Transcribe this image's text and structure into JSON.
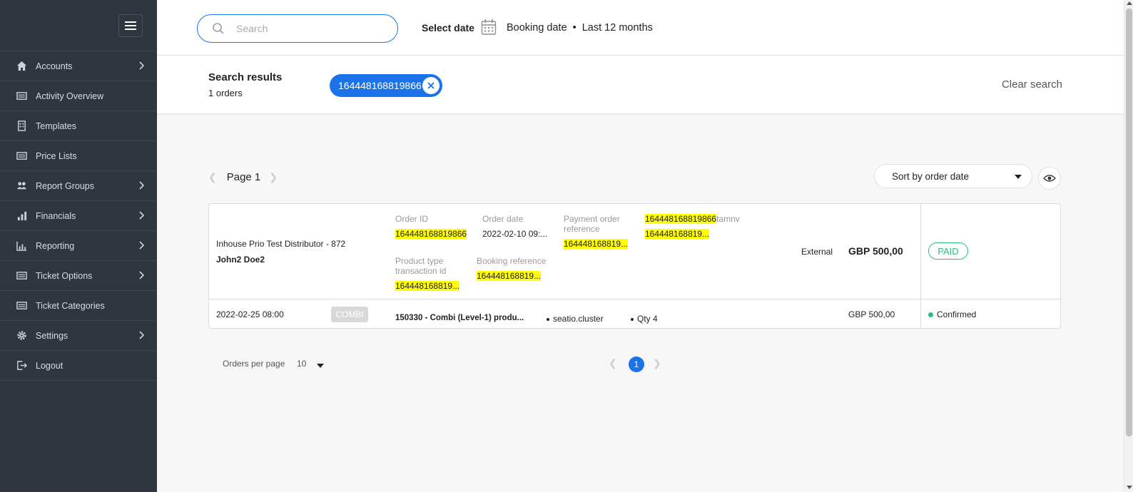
{
  "sidebar": {
    "items": [
      {
        "label": "Accounts",
        "icon": "home-icon",
        "has_submenu": true
      },
      {
        "label": "Activity Overview",
        "icon": "list-icon",
        "has_submenu": false
      },
      {
        "label": "Templates",
        "icon": "building-icon",
        "has_submenu": false
      },
      {
        "label": "Price Lists",
        "icon": "list-icon",
        "has_submenu": false
      },
      {
        "label": "Report Groups",
        "icon": "users-icon",
        "has_submenu": true
      },
      {
        "label": "Financials",
        "icon": "bar-chart-icon",
        "has_submenu": true
      },
      {
        "label": "Reporting",
        "icon": "chart-icon",
        "has_submenu": true
      },
      {
        "label": "Ticket Options",
        "icon": "list-icon",
        "has_submenu": true
      },
      {
        "label": "Ticket Categories",
        "icon": "list-icon",
        "has_submenu": false
      },
      {
        "label": "Settings",
        "icon": "gear-icon",
        "has_submenu": true
      },
      {
        "label": "Logout",
        "icon": "logout-icon",
        "has_submenu": false
      }
    ]
  },
  "header": {
    "search_placeholder": "Search",
    "select_date_label": "Select date",
    "date_type": "Booking date",
    "date_separator": "•",
    "date_range": "Last 12 months"
  },
  "results": {
    "title": "Search results",
    "count": "1 orders",
    "chip": "164448168819866",
    "clear_label": "Clear search"
  },
  "paging": {
    "page_label": "Page 1",
    "sort_label": "Sort by order date",
    "orders_per_page_label": "Orders per page",
    "orders_per_page_value": "10",
    "current_page": "1"
  },
  "order": {
    "distributor": "Inhouse Prio Test Distributor - 872",
    "customer": "John2 Doe2",
    "order_id_label": "Order ID",
    "order_id": "164448168819866",
    "order_date_label": "Order date",
    "order_date": "2022-02-10 09:...",
    "payment_ref_label": "Payment order reference",
    "payment_ref_label_1": "Payment order",
    "payment_ref_label_2": "reference",
    "payment_ref": "164448168819...",
    "extra_ref_highlight": "164448168819866",
    "extra_ref_suffix": "tamnv",
    "extra_ref_2": "164448168819...",
    "product_type_label_1": "Product type",
    "product_type_label_2": "transaction id",
    "product_type_id": "164448168819...",
    "booking_ref_label": "Booking reference",
    "booking_ref": "164448168819...",
    "channel": "External",
    "amount": "GBP 500,00",
    "status": "PAID",
    "line": {
      "datetime": "2022-02-25 08:00",
      "badge": "COMBI",
      "product": "150330 - Combi (Level-1) produ...",
      "location": "seatio.cluster",
      "qty": "Qty 4",
      "amount": "GBP 500,00",
      "status": "Confirmed"
    }
  },
  "colors": {
    "sidebar_bg": "#2f3640",
    "accent": "#1a73e8",
    "paid_green": "#2dbd7e",
    "highlight": "#ffff00"
  }
}
